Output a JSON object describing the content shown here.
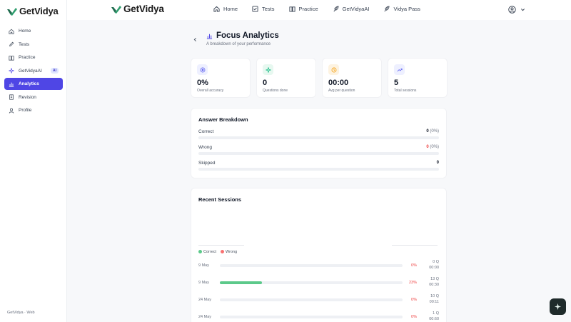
{
  "brand": {
    "name": "GetVidya"
  },
  "sidebar": {
    "items": [
      {
        "label": "Home",
        "icon": "home-icon"
      },
      {
        "label": "Tests",
        "icon": "pencil-icon"
      },
      {
        "label": "Practice",
        "icon": "book-icon"
      },
      {
        "label": "GetVidyaAI",
        "icon": "sparkle-icon",
        "badge": "AI"
      },
      {
        "label": "Analytics",
        "icon": "bar-chart-icon",
        "active": true
      },
      {
        "label": "Revision",
        "icon": "document-icon"
      },
      {
        "label": "Profile",
        "icon": "user-icon"
      }
    ],
    "footer": "GetVidya · Web"
  },
  "topnav": {
    "links": [
      {
        "label": "Home",
        "icon": "home-icon"
      },
      {
        "label": "Tests",
        "icon": "checklist-icon"
      },
      {
        "label": "Practice",
        "icon": "book-icon"
      },
      {
        "label": "GetVidyaAI",
        "icon": "feather-icon"
      },
      {
        "label": "Vidya Pass",
        "icon": "feather-icon"
      }
    ]
  },
  "page": {
    "title": "Focus Analytics",
    "subtitle": "A breakdown of your performance"
  },
  "stats": [
    {
      "value": "0%",
      "label": "Overall accuracy",
      "icon": "target-icon",
      "color": "#6366f1",
      "bg": "#eef0ff"
    },
    {
      "value": "0",
      "label": "Questions done",
      "icon": "sparkle-icon",
      "color": "#10b981",
      "bg": "#e7f8f0"
    },
    {
      "value": "00:00",
      "label": "Avg per question",
      "icon": "clock-icon",
      "color": "#f59e0b",
      "bg": "#fdf3e1"
    },
    {
      "value": "5",
      "label": "Total sessions",
      "icon": "trend-icon",
      "color": "#6366f1",
      "bg": "#eef0ff"
    }
  ],
  "breakdown": {
    "title": "Answer Breakdown",
    "rows": [
      {
        "label": "Correct",
        "count": "0",
        "pct": "(0%)"
      },
      {
        "label": "Wrong",
        "count": "0",
        "pct": "(0%)"
      },
      {
        "label": "Skipped",
        "count": "0",
        "pct": ""
      }
    ]
  },
  "sessions": {
    "title": "Recent Sessions",
    "legend": [
      {
        "label": "Correct",
        "color": "#5cc98a"
      },
      {
        "label": "Wrong",
        "color": "#f87171"
      }
    ],
    "rows": [
      {
        "date": "9 May",
        "accuracy": 0,
        "pct": "0%",
        "questions": "0 Q",
        "time": "00:00"
      },
      {
        "date": "9 May",
        "accuracy": 0.23,
        "pct": "23%",
        "questions": "13 Q",
        "time": "00:30"
      },
      {
        "date": "24 May",
        "accuracy": 0,
        "pct": "0%",
        "questions": "10 Q",
        "time": "00:11"
      },
      {
        "date": "24 May",
        "accuracy": 0,
        "pct": "0%",
        "questions": "1 Q",
        "time": "00:60"
      }
    ]
  },
  "colors": {
    "accent": "#4f46e5",
    "correct": "#5cc98a",
    "wrong": "#ef4444"
  }
}
